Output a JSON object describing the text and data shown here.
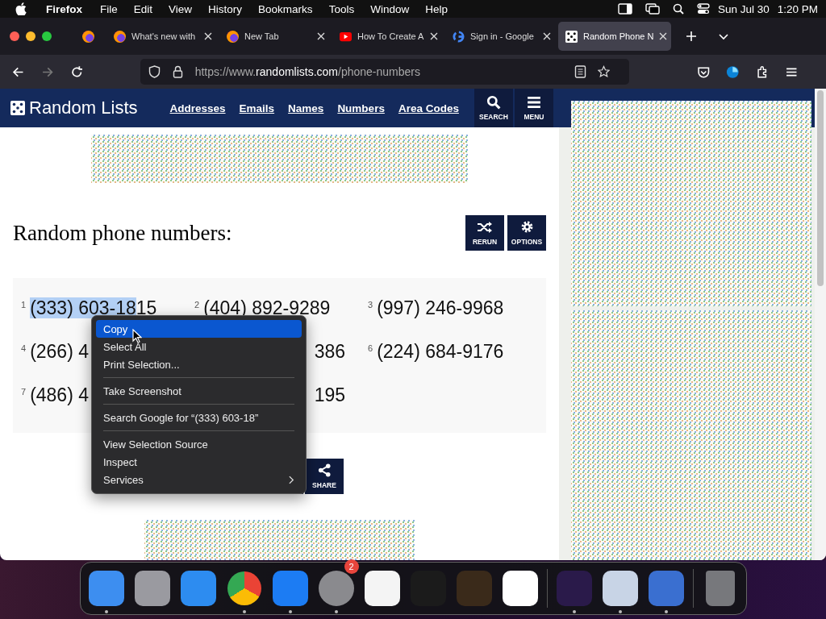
{
  "menubar": {
    "app": "Firefox",
    "items": [
      "File",
      "Edit",
      "View",
      "History",
      "Bookmarks",
      "Tools",
      "Window",
      "Help"
    ],
    "date": "Sun Jul 30",
    "time": "1:20 PM"
  },
  "tabs": [
    {
      "kind": "pinned",
      "selected": false
    },
    {
      "kind": "firefox",
      "title": "What's new with",
      "selected": false
    },
    {
      "kind": "firefox",
      "title": "New Tab",
      "selected": false
    },
    {
      "kind": "youtube",
      "title": "How To Create A",
      "selected": false
    },
    {
      "kind": "google",
      "title": "Sign in - Google",
      "selected": false
    },
    {
      "kind": "dice",
      "title": "Random Phone N",
      "selected": true
    }
  ],
  "address": {
    "prefix": "https://www.",
    "domain": "randomlists.com",
    "path": "/phone-numbers"
  },
  "site": {
    "logo": "Random Lists",
    "nav": [
      "Addresses",
      "Emails",
      "Names",
      "Numbers",
      "Area Codes"
    ],
    "search": "SEARCH",
    "menu": "MENU"
  },
  "heading": "Random phone numbers:",
  "actions": [
    {
      "kind": "rerun",
      "label": "RERUN"
    },
    {
      "kind": "options",
      "label": "OPTIONS"
    }
  ],
  "numbers": [
    {
      "kind": "full",
      "index": "1",
      "selected_text": "(333) 603-18",
      "text": "15"
    },
    {
      "kind": "full",
      "index": "2",
      "text": "(404) 892-9289"
    },
    {
      "kind": "full",
      "index": "3",
      "text": "(997) 246-9968"
    },
    {
      "kind": "cut",
      "index": "4",
      "text": "(266) 4"
    },
    {
      "kind": "tail",
      "text": "386"
    },
    {
      "kind": "full",
      "index": "6",
      "text": "(224) 684-9176"
    },
    {
      "kind": "cut",
      "index": "7",
      "text": "(486) 4"
    },
    {
      "kind": "tail",
      "text": "195"
    }
  ],
  "share": {
    "label": "SHARE"
  },
  "context_menu": [
    {
      "kind": "item",
      "label": "Copy",
      "selected": true
    },
    {
      "kind": "item",
      "label": "Select All",
      "selected": false
    },
    {
      "kind": "item",
      "label": "Print Selection...",
      "selected": false
    },
    {
      "kind": "separator"
    },
    {
      "kind": "item",
      "label": "Take Screenshot",
      "selected": false
    },
    {
      "kind": "separator"
    },
    {
      "kind": "item",
      "label": "Search Google for “(333) 603-18”",
      "selected": false
    },
    {
      "kind": "separator"
    },
    {
      "kind": "item",
      "label": "View Selection Source",
      "selected": false
    },
    {
      "kind": "item",
      "label": "Inspect",
      "selected": false
    },
    {
      "kind": "submenu",
      "label": "Services",
      "selected": false
    }
  ],
  "dock": [
    {
      "kind": "finder",
      "running": true
    },
    {
      "kind": "launchpad",
      "running": false
    },
    {
      "kind": "safari",
      "running": false
    },
    {
      "kind": "chrome",
      "running": true
    },
    {
      "kind": "appstore",
      "running": true
    },
    {
      "kind": "settings",
      "running": true,
      "badge": "2"
    },
    {
      "kind": "textedit",
      "running": false
    },
    {
      "kind": "terminal",
      "running": false
    },
    {
      "kind": "garageband",
      "running": false
    },
    {
      "kind": "vscode",
      "running": false
    },
    {
      "kind": "divider"
    },
    {
      "kind": "firefox",
      "running": true
    },
    {
      "kind": "virtualbox",
      "running": true
    },
    {
      "kind": "parallels",
      "running": true
    },
    {
      "kind": "divider"
    },
    {
      "kind": "trash",
      "running": false
    }
  ]
}
